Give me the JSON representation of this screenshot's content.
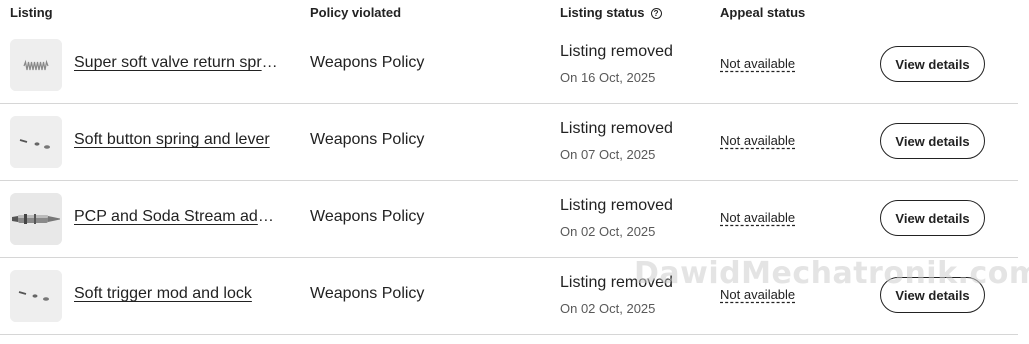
{
  "table": {
    "headers": {
      "listing": "Listing",
      "policy": "Policy violated",
      "status": "Listing status",
      "appeal": "Appeal status"
    },
    "rows": [
      {
        "title": "Super soft valve return spring",
        "policy": "Weapons Policy",
        "status": "Listing removed",
        "date": "On 16 Oct, 2025",
        "appeal": "Not available",
        "button": "View details",
        "thumbnail": "spring-thumbnail"
      },
      {
        "title": "Soft button spring and lever",
        "policy": "Weapons Policy",
        "status": "Listing removed",
        "date": "On 07 Oct, 2025",
        "appeal": "Not available",
        "button": "View details",
        "thumbnail": "small-parts-thumbnail"
      },
      {
        "title": "PCP and Soda Stream adapter",
        "policy": "Weapons Policy",
        "status": "Listing removed",
        "date": "On 02 Oct, 2025",
        "appeal": "Not available",
        "button": "View details",
        "thumbnail": "metal-pin-thumbnail"
      },
      {
        "title": "Soft trigger mod and lock",
        "policy": "Weapons Policy",
        "status": "Listing removed",
        "date": "On 02 Oct, 2025",
        "appeal": "Not available",
        "button": "View details",
        "thumbnail": "small-parts-thumbnail"
      }
    ]
  },
  "watermark": "DawidMechatronik.com",
  "icons": {
    "status_help": "question-circle-icon"
  },
  "colors": {
    "text": "#222222",
    "muted": "#595959",
    "divider": "#d6d6d6",
    "thumb_bg": "#ececec"
  }
}
